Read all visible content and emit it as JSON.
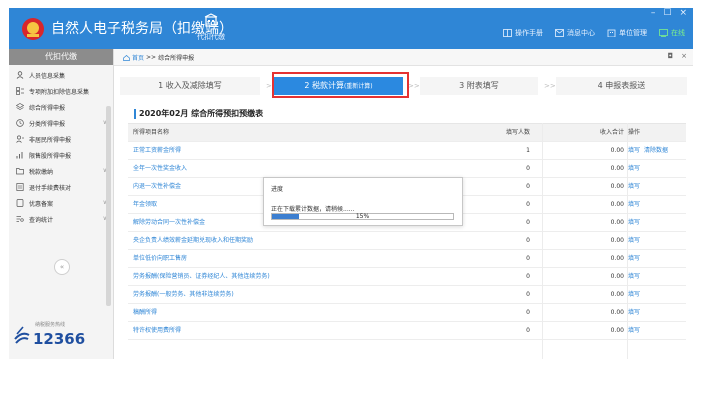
{
  "app": {
    "title": "自然人电子税务局（扣缴端）",
    "agent_entry_label": "代扣代缴"
  },
  "topnav": [
    {
      "label": "操作手册",
      "icon": "book-icon"
    },
    {
      "label": "消息中心",
      "icon": "mail-icon"
    },
    {
      "label": "单位管理",
      "icon": "building-icon"
    },
    {
      "label": "在线",
      "icon": "online-status-icon"
    }
  ],
  "window_controls": {
    "minimize": "–",
    "maximize": "☐",
    "close": "×"
  },
  "sidebar": {
    "header": "代扣代缴",
    "items": [
      {
        "label": "人员信息采集",
        "icon": "user-icon",
        "chevron": false
      },
      {
        "label": "专项附加扣除信息采集",
        "icon": "list-icon",
        "chevron": false
      },
      {
        "label": "综合所得申报",
        "icon": "layers-icon",
        "chevron": false
      },
      {
        "label": "分类所得申报",
        "icon": "clock-icon",
        "chevron": true
      },
      {
        "label": "非居民所得申报",
        "icon": "person-icon",
        "chevron": false
      },
      {
        "label": "限售股所得申报",
        "icon": "bar-chart-icon",
        "chevron": false
      },
      {
        "label": "税款缴纳",
        "icon": "folder-icon",
        "chevron": true
      },
      {
        "label": "退付手续费核对",
        "icon": "receipt-icon",
        "chevron": false
      },
      {
        "label": "优惠备案",
        "icon": "document-icon",
        "chevron": true
      },
      {
        "label": "查询统计",
        "icon": "query-icon",
        "chevron": true
      }
    ],
    "collapse": "«",
    "hotline_caption": "纳税服务热线",
    "hotline_number": "12366"
  },
  "breadcrumb": {
    "home": "首页",
    "sep": ">>",
    "current": "综合所得申报"
  },
  "tab_controls": {
    "menu": "◘",
    "close": "×"
  },
  "steps": [
    {
      "label": "1 收入及减除填写",
      "active": false
    },
    {
      "label": "2 税款计算",
      "sub": "(重新计算)",
      "active": true
    },
    {
      "label": "3 附表填写",
      "active": false
    },
    {
      "label": "4 申报表报送",
      "active": false
    }
  ],
  "step_arrows": [
    ">",
    ">>",
    ">>"
  ],
  "section_title": "2020年02月  综合所得预扣预缴表",
  "table": {
    "headers": {
      "name": "所得项目名称",
      "count": "填写人数",
      "income": "收入合计",
      "ops": "操作"
    },
    "rows": [
      {
        "name": "正常工资薪金所得",
        "count": "1",
        "income": "0.00",
        "ops": [
          "填写",
          "清除数据"
        ]
      },
      {
        "name": "全年一次性奖金收入",
        "count": "0",
        "income": "0.00",
        "ops": [
          "填写"
        ]
      },
      {
        "name": "内退一次性补偿金",
        "count": "0",
        "income": "0.00",
        "ops": [
          "填写"
        ]
      },
      {
        "name": "年金领取",
        "count": "0",
        "income": "0.00",
        "ops": [
          "填写"
        ]
      },
      {
        "name": "解除劳动合同一次性补偿金",
        "count": "0",
        "income": "0.00",
        "ops": [
          "填写"
        ]
      },
      {
        "name": "央企负责人绩效薪金延期兑现收入和任期奖励",
        "count": "0",
        "income": "0.00",
        "ops": [
          "填写"
        ]
      },
      {
        "name": "单位低价向职工售房",
        "count": "0",
        "income": "0.00",
        "ops": [
          "填写"
        ]
      },
      {
        "name": "劳务报酬(保险营销员、证券经纪人、其他连续劳务)",
        "count": "0",
        "income": "0.00",
        "ops": [
          "填写"
        ]
      },
      {
        "name": "劳务报酬(一般劳务、其他非连续劳务)",
        "count": "0",
        "income": "0.00",
        "ops": [
          "填写"
        ]
      },
      {
        "name": "稿酬所得",
        "count": "0",
        "income": "0.00",
        "ops": [
          "填写"
        ]
      },
      {
        "name": "特许权使用费所得",
        "count": "0",
        "income": "0.00",
        "ops": [
          "填写"
        ]
      }
    ]
  },
  "dialog": {
    "title": "进度",
    "message": "正在下载累计数据，请稍候......",
    "progress": 0.15,
    "progress_label": "15%"
  }
}
